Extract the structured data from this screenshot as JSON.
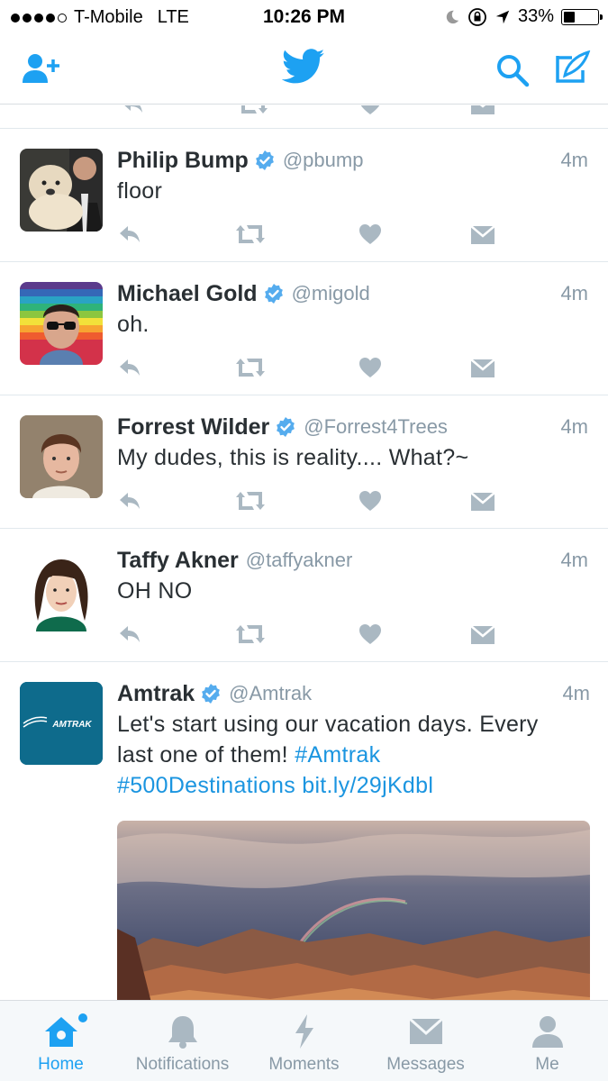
{
  "status_bar": {
    "carrier": "T-Mobile",
    "network": "LTE",
    "time": "10:26 PM",
    "battery": "33%",
    "battery_level": 0.33
  },
  "nav_bar": {
    "left_icon": "add-user-icon",
    "center_icon": "twitter-bird-icon",
    "right_icons": [
      "search-icon",
      "compose-icon"
    ]
  },
  "tweets": [
    {
      "name": "Philip Bump",
      "verified": true,
      "handle": "@pbump",
      "time": "4m",
      "text": "floor"
    },
    {
      "name": "Michael Gold",
      "verified": true,
      "handle": "@migold",
      "time": "4m",
      "text": "oh."
    },
    {
      "name": "Forrest Wilder",
      "verified": true,
      "handle": "@Forrest4Trees",
      "time": "4m",
      "text": "My dudes, this is reality.... What?~"
    },
    {
      "name": "Taffy Akner",
      "verified": false,
      "handle": "@taffyakner",
      "time": "4m",
      "text": "OH NO"
    },
    {
      "name": "Amtrak",
      "verified": true,
      "handle": "@Amtrak",
      "time": "4m",
      "text_line1": "Let's start using our vacation days. Every",
      "text_line2_plain": "last one of them! ",
      "hashtag1": "#Amtrak",
      "hashtag2": "#500Destinations",
      "link": "bit.ly/29jKdbl",
      "avatar_text": "AMTRAK"
    }
  ],
  "tab_bar": {
    "tabs": [
      {
        "label": "Home",
        "icon": "home-icon",
        "active": true
      },
      {
        "label": "Notifications",
        "icon": "bell-icon",
        "active": false
      },
      {
        "label": "Moments",
        "icon": "lightning-icon",
        "active": false
      },
      {
        "label": "Messages",
        "icon": "envelope-icon",
        "active": false
      },
      {
        "label": "Me",
        "icon": "person-icon",
        "active": false
      }
    ]
  },
  "colors": {
    "accent": "#1da1f2",
    "link": "#1b95e0",
    "muted": "#8899a6",
    "text": "#292f33"
  }
}
